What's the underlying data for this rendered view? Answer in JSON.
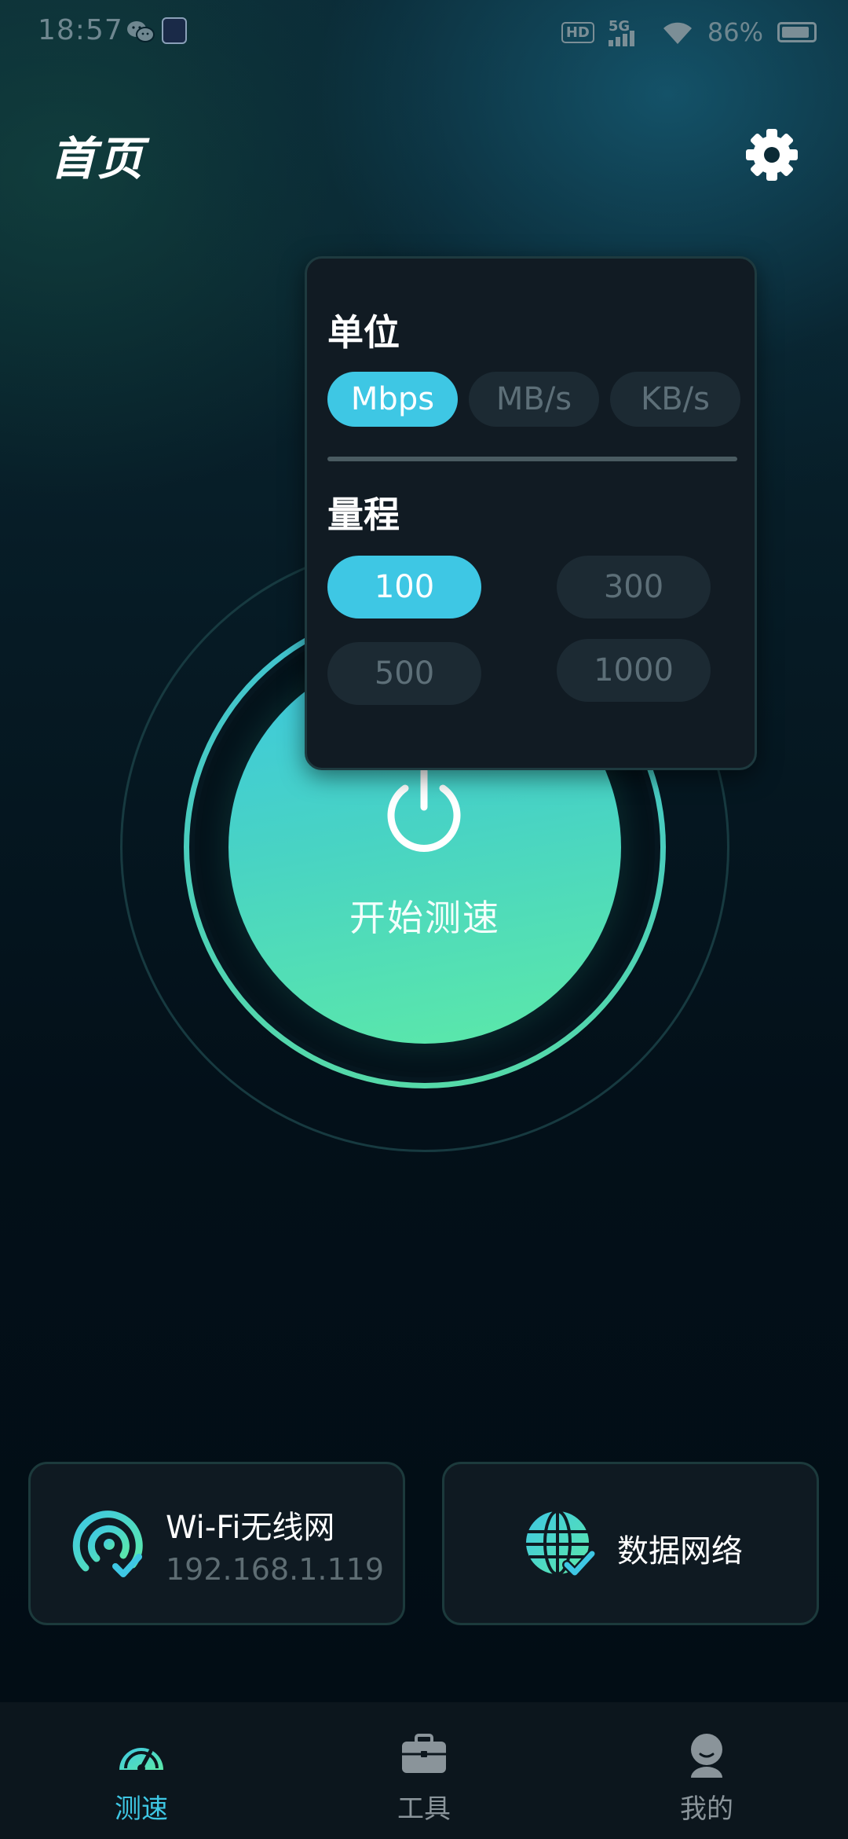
{
  "status_bar": {
    "time": "18:57",
    "battery": "86%",
    "hd": "HD",
    "network_type": "5G",
    "icons": [
      "wechat-icon",
      "app-notification-icon",
      "hd-voice-icon",
      "signal-5g-icon",
      "wifi-icon",
      "battery-icon"
    ]
  },
  "header": {
    "title": "首页",
    "settings_icon": "gear-icon"
  },
  "popup": {
    "unit_heading": "单位",
    "units": [
      {
        "label": "Mbps",
        "selected": true
      },
      {
        "label": "MB/s",
        "selected": false
      },
      {
        "label": "KB/s",
        "selected": false
      }
    ],
    "range_heading": "量程",
    "ranges": [
      {
        "label": "100",
        "selected": true
      },
      {
        "label": "300",
        "selected": false
      },
      {
        "label": "500",
        "selected": false
      },
      {
        "label": "1000",
        "selected": false
      }
    ]
  },
  "speedtest": {
    "start_label": "开始测速",
    "icon": "power-icon"
  },
  "network_cards": {
    "wifi": {
      "title": "Wi-Fi无线网",
      "ip": "192.168.1.119",
      "icon": "wifi-check-icon"
    },
    "data": {
      "title": "数据网络",
      "icon": "globe-check-icon"
    }
  },
  "bottom_nav": {
    "items": [
      {
        "label": "测速",
        "icon": "speedometer-icon",
        "active": true
      },
      {
        "label": "工具",
        "icon": "toolbox-icon",
        "active": false
      },
      {
        "label": "我的",
        "icon": "user-icon",
        "active": false
      }
    ]
  },
  "colors": {
    "accent": "#3ec7e4",
    "accent_green": "#5ce9a8",
    "background": "#031019",
    "card": "#0f1a22",
    "inactive_chip": "#1c2a33"
  }
}
